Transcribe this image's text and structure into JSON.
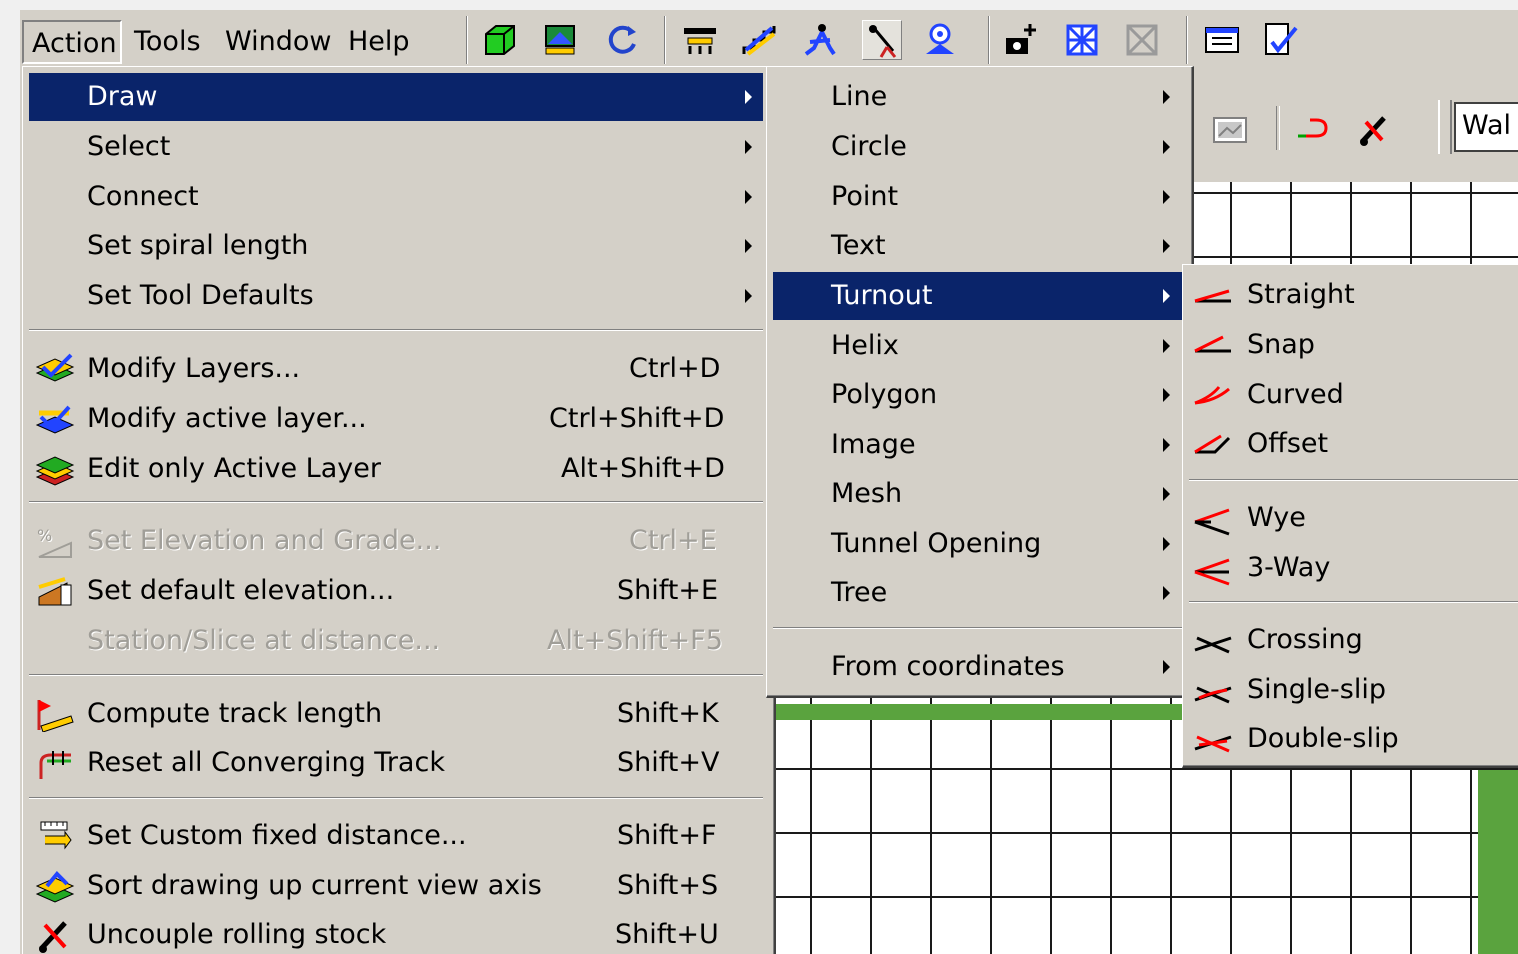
{
  "menubar": {
    "action": "Action",
    "tools": "Tools",
    "window": "Window",
    "help": "Help"
  },
  "toolbar_icons": [
    "cube-icon",
    "layers-scene-icon",
    "refresh-icon",
    "track-tool-icon",
    "stairs-icon",
    "figure-icon",
    "pointer-icon",
    "target-icon",
    "camera-add-icon",
    "grid-box-icon",
    "grid-box-disabled-icon",
    "window-icon",
    "checklist-icon"
  ],
  "subtoolbar": {
    "field_value": "Wal"
  },
  "action_menu": {
    "draw": "Draw",
    "select": "Select",
    "connect": "Connect",
    "set_spiral_length": "Set spiral length",
    "set_tool_defaults": "Set Tool Defaults",
    "modify_layers": "Modify Layers...",
    "modify_layers_sc": "Ctrl+D",
    "modify_active_layer": "Modify active layer...",
    "modify_active_layer_sc": "Ctrl+Shift+D",
    "edit_only_active": "Edit only Active Layer",
    "edit_only_active_sc": "Alt+Shift+D",
    "set_elevation": "Set Elevation and Grade...",
    "set_elevation_sc": "Ctrl+E",
    "set_default_elevation": "Set default elevation...",
    "set_default_elevation_sc": "Shift+E",
    "station_slice": "Station/Slice at distance...",
    "station_slice_sc": "Alt+Shift+F5",
    "compute_track_length": "Compute track length",
    "compute_track_length_sc": "Shift+K",
    "reset_converging": "Reset all Converging Track",
    "reset_converging_sc": "Shift+V",
    "set_custom_distance": "Set Custom fixed distance...",
    "set_custom_distance_sc": "Shift+F",
    "sort_drawing": "Sort drawing up current view axis",
    "sort_drawing_sc": "Shift+S",
    "uncouple": "Uncouple rolling stock",
    "uncouple_sc": "Shift+U"
  },
  "draw_menu": {
    "line": "Line",
    "circle": "Circle",
    "point": "Point",
    "text": "Text",
    "turnout": "Turnout",
    "helix": "Helix",
    "polygon": "Polygon",
    "image": "Image",
    "mesh": "Mesh",
    "tunnel_opening": "Tunnel Opening",
    "tree": "Tree",
    "from_coordinates": "From coordinates"
  },
  "turnout_menu": {
    "straight": "Straight",
    "snap": "Snap",
    "curved": "Curved",
    "offset": "Offset",
    "wye": "Wye",
    "three_way": "3-Way",
    "crossing": "Crossing",
    "single_slip": "Single-slip",
    "double_slip": "Double-slip"
  },
  "colors": {
    "menu_face": "#d4d0c8",
    "selection": "#0a246a",
    "track_green": "#5aa33e",
    "turnout_red": "#ff0000"
  }
}
